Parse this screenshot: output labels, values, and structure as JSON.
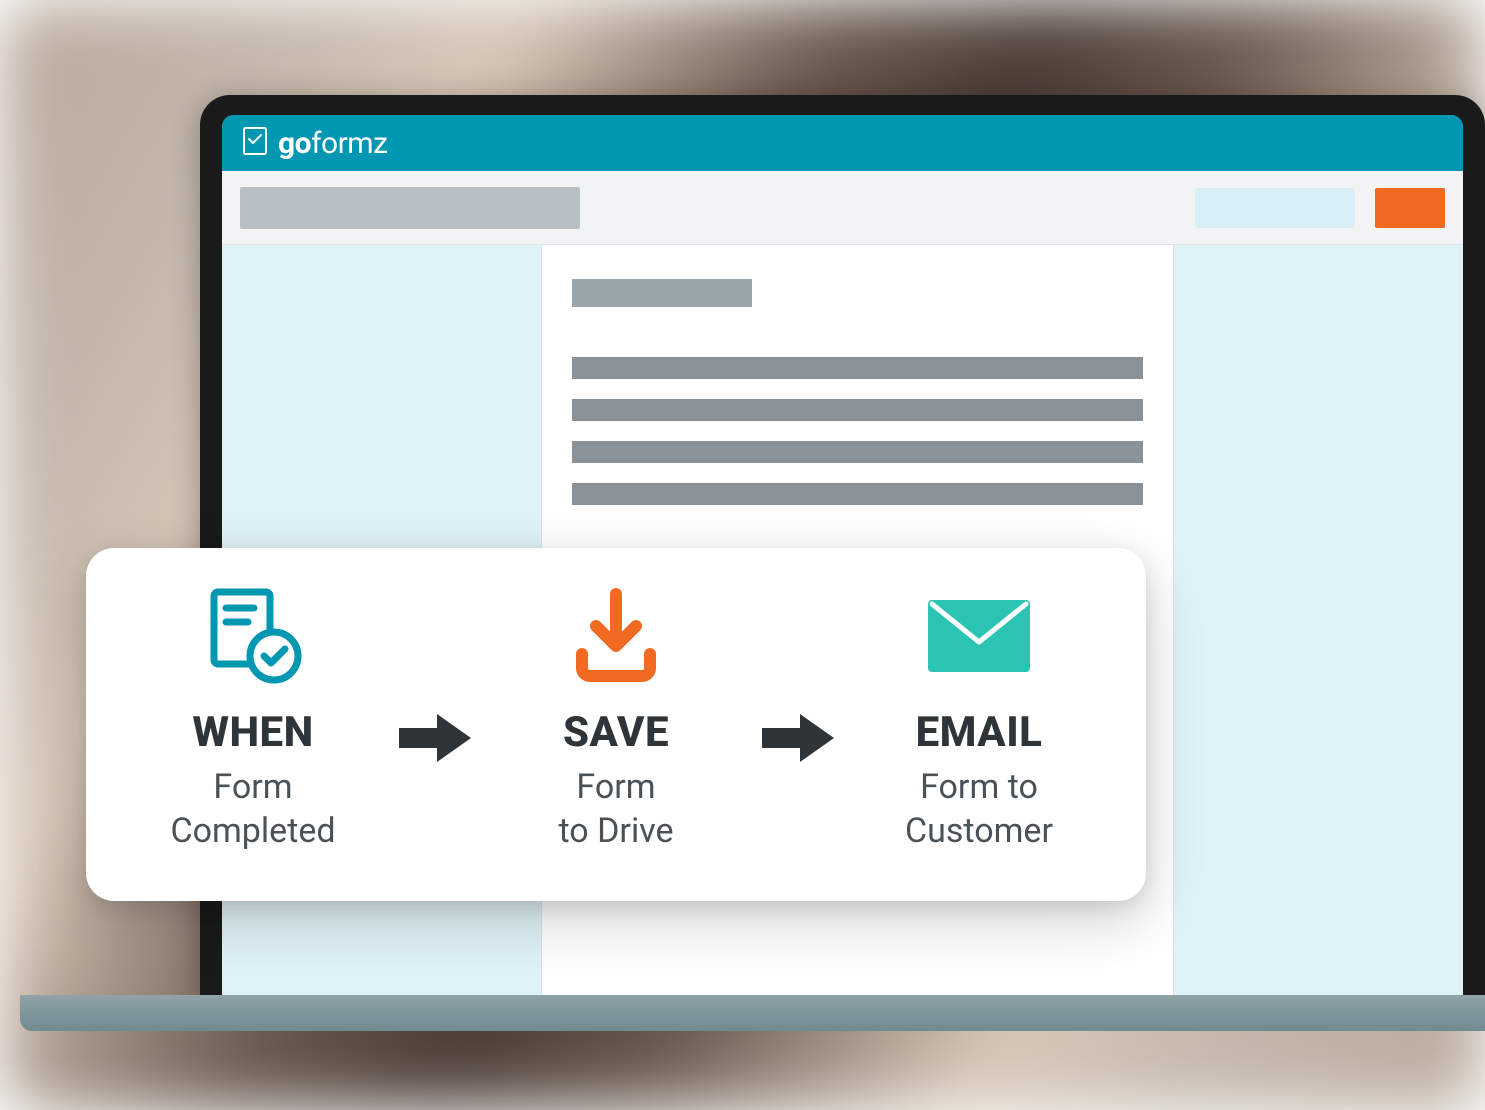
{
  "brand": {
    "name_prefix": "go",
    "name_suffix": "formz",
    "color": "#0097b2"
  },
  "colors": {
    "accent_orange": "#f26a21",
    "teal": "#2bc4b2",
    "logo_cyan": "#0097b2",
    "light_panel": "#dff2f7"
  },
  "workflow": {
    "steps": [
      {
        "title": "WHEN",
        "line1": "Form",
        "line2": "Completed",
        "icon": "form-check-icon"
      },
      {
        "title": "SAVE",
        "line1": "Form",
        "line2": "to Drive",
        "icon": "download-icon"
      },
      {
        "title": "EMAIL",
        "line1": "Form to",
        "line2": "Customer",
        "icon": "envelope-icon"
      }
    ]
  }
}
